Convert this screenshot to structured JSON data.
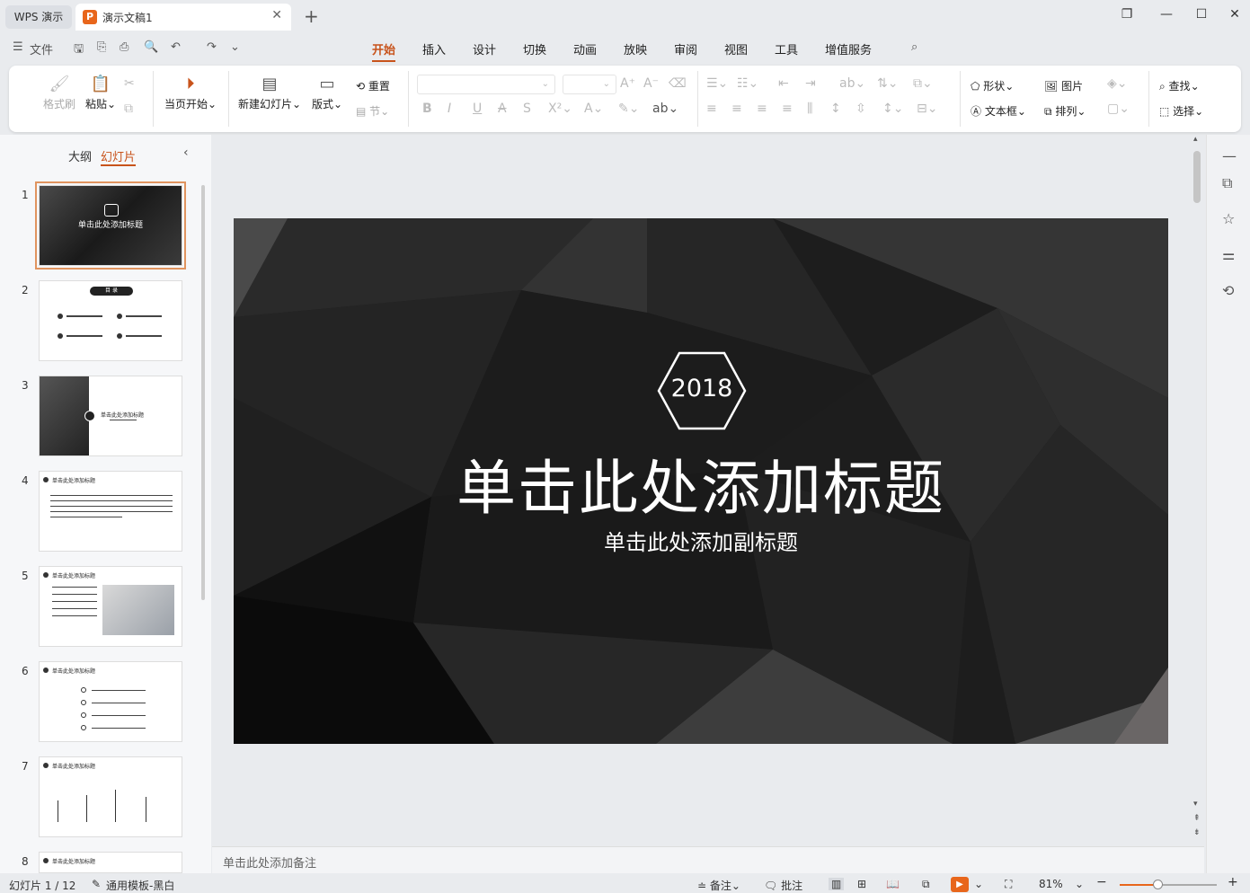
{
  "titlebar": {
    "app_tab": "WPS 演示",
    "doc_tab_icon": "P",
    "doc_tab": "演示文稿1"
  },
  "menu": {
    "file": "文件",
    "items": [
      "开始",
      "插入",
      "设计",
      "切换",
      "动画",
      "放映",
      "审阅",
      "视图",
      "工具",
      "增值服务"
    ],
    "active": "开始"
  },
  "ribbon": {
    "format_painter": "格式刷",
    "paste": "粘贴",
    "from_current": "当页开始",
    "new_slide": "新建幻灯片",
    "layout": "版式",
    "reset": "重置",
    "section": "节",
    "shape": "形状",
    "picture": "图片",
    "textbox": "文本框",
    "arrange": "排列",
    "find": "查找",
    "select": "选择"
  },
  "left_panel": {
    "tab_outline": "大纲",
    "tab_slides": "幻灯片",
    "slides": [
      {
        "num": "1",
        "title": "单击此处添加标题"
      },
      {
        "num": "2",
        "title": "目    录"
      },
      {
        "num": "3",
        "title": "单击此处添加标题"
      },
      {
        "num": "4",
        "title": "单击此处添加标题"
      },
      {
        "num": "5",
        "title": "单击此处添加标题"
      },
      {
        "num": "6",
        "title": "单击此处添加标题"
      },
      {
        "num": "7",
        "title": "单击此处添加标题"
      },
      {
        "num": "8",
        "title": "单击此处添加标题"
      }
    ]
  },
  "slide": {
    "year": "2018",
    "title": "单击此处添加标题",
    "subtitle": "单击此处添加副标题"
  },
  "notes": {
    "placeholder": "单击此处添加备注"
  },
  "status": {
    "slide_count": "幻灯片 1 / 12",
    "template": "通用模板-黑白",
    "notes": "备注",
    "comments": "批注",
    "zoom": "81%",
    "zoom_level": 0.39
  },
  "colors": {
    "accent": "#c8531b",
    "play": "#e8661b"
  }
}
